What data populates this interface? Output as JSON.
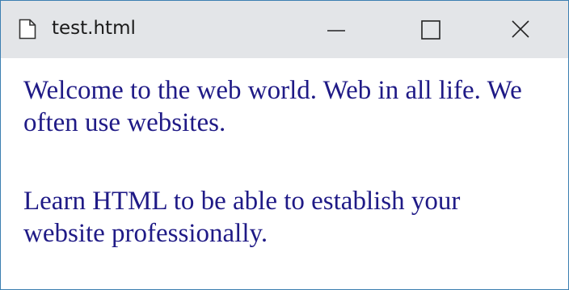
{
  "window": {
    "title": "test.html",
    "controls": {
      "minimize_icon": "minimize-icon",
      "maximize_icon": "maximize-icon",
      "close_icon": "close-icon"
    }
  },
  "content": {
    "paragraphs": [
      "Welcome to the web world. Web in all life. We often use websites.",
      "Learn HTML to be able to establish your website professionally."
    ]
  },
  "colors": {
    "titlebar_bg": "#e3e5e8",
    "window_border": "#3c7fb1",
    "text_color": "#1f1a86"
  }
}
